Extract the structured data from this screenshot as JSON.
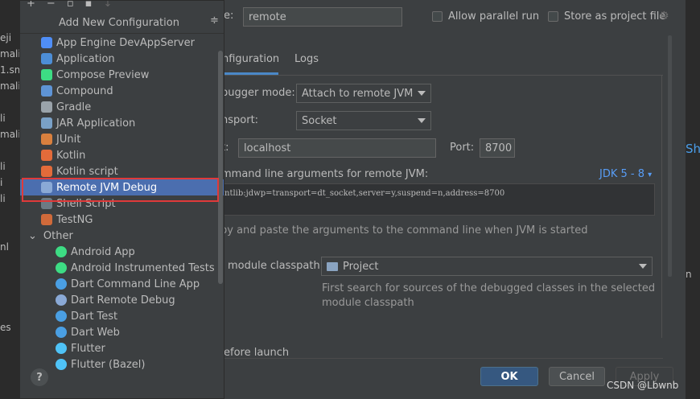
{
  "background_strip": {
    "items": [
      "eji",
      "mali",
      "1.sm",
      "mali",
      "li",
      "mali",
      "li",
      "i",
      "li",
      "nl",
      "es"
    ]
  },
  "right_strip": {
    "text": "Shi",
    "text2": "n"
  },
  "dialog": {
    "name_label_suffix": "e:",
    "name_value": "remote",
    "allow_parallel_label": "Allow parallel run",
    "store_project_label": "Store as project file",
    "tabs": [
      "nfiguration",
      "Logs"
    ],
    "debugger_mode_label": "bugger mode:",
    "debugger_mode_value": "Attach to remote JVM",
    "transport_label": "nsport:",
    "transport_value": "Socket",
    "host_label": "t:",
    "host_value": "localhost",
    "port_label": "Port:",
    "port_value": "8700",
    "cmdline_label": "mmand line arguments for remote JVM:",
    "jdk_label": "JDK 5 - 8",
    "cmdline_value": "ntlib:jdwp=transport=dt_socket,server=y,suspend=n,address=8700",
    "hint": "py and paste the arguments to the command line when JVM is started",
    "module_label": "module classpath:",
    "module_value": "Project",
    "module_hint_1": "First search for sources of the debugged classes in the selected",
    "module_hint_2": "module classpath",
    "before_launch": "efore launch",
    "ok": "OK",
    "cancel": "Cancel",
    "apply": "Apply",
    "watermark": "CSDN @Lbwnb"
  },
  "popup": {
    "title": "Add New Configuration",
    "items": [
      {
        "label": "App Engine DevAppServer",
        "icon": "app-engine-icon"
      },
      {
        "label": "Application",
        "icon": "application-icon"
      },
      {
        "label": "Compose Preview",
        "icon": "compose-icon"
      },
      {
        "label": "Compound",
        "icon": "compound-icon"
      },
      {
        "label": "Gradle",
        "icon": "gradle-icon"
      },
      {
        "label": "JAR Application",
        "icon": "jar-icon"
      },
      {
        "label": "JUnit",
        "icon": "junit-icon"
      },
      {
        "label": "Kotlin",
        "icon": "kotlin-icon"
      },
      {
        "label": "Kotlin script",
        "icon": "kotlin-script-icon"
      },
      {
        "label": "Remote JVM Debug",
        "icon": "remote-debug-icon"
      },
      {
        "label": "Shell Script",
        "icon": "shell-icon"
      },
      {
        "label": "TestNG",
        "icon": "testng-icon"
      }
    ],
    "other_label": "Other",
    "other_items": [
      {
        "label": "Android App",
        "icon": "android-icon"
      },
      {
        "label": "Android Instrumented Tests",
        "icon": "android-icon"
      },
      {
        "label": "Dart Command Line App",
        "icon": "dart-icon"
      },
      {
        "label": "Dart Remote Debug",
        "icon": "dart-remote-icon"
      },
      {
        "label": "Dart Test",
        "icon": "dart-test-icon"
      },
      {
        "label": "Dart Web",
        "icon": "dart-web-icon"
      },
      {
        "label": "Flutter",
        "icon": "flutter-icon"
      },
      {
        "label": "Flutter (Bazel)",
        "icon": "flutter-icon"
      }
    ],
    "help": "?"
  },
  "colors": {
    "selection": "#4b6eaf",
    "highlight_border": "#e03a3a",
    "link": "#589df6",
    "ok_button": "#365880"
  }
}
